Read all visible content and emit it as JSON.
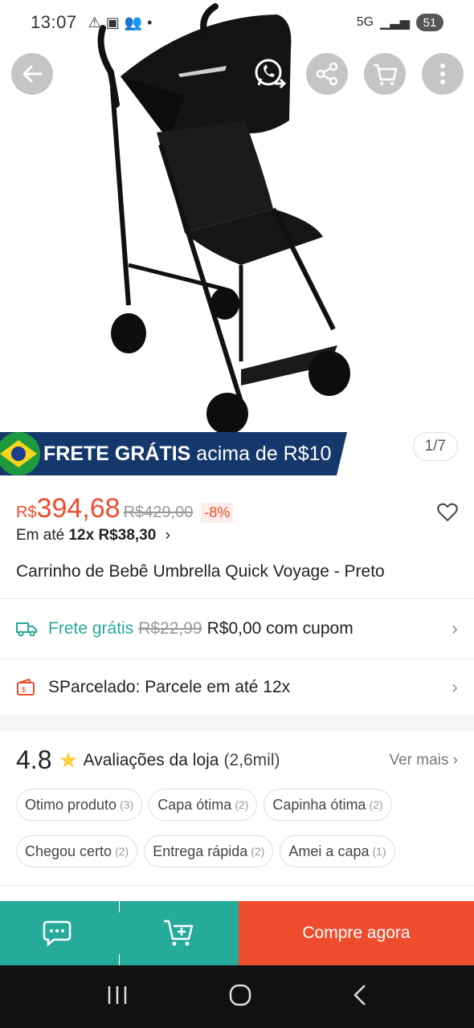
{
  "status_bar": {
    "time": "13:07",
    "network": "5G",
    "battery": "51"
  },
  "hero": {
    "counter": "1/7"
  },
  "top_actions": [
    "back-icon",
    "whatsapp-share-icon",
    "share-icon",
    "cart-icon",
    "more-icon"
  ],
  "banner": {
    "bold": "FRETE GRÁTIS",
    "rest": " acima de R$10"
  },
  "price": {
    "currency": "R$",
    "value": "394,68",
    "old": "R$429,00",
    "discount": "-8%"
  },
  "installment": {
    "prefix": "Em até ",
    "bold": "12x R$38,30",
    "chevron": "›"
  },
  "product_title": "Carrinho de Bebê Umbrella Quick Voyage - Preto",
  "shipping": {
    "label": "Frete grátis",
    "old": "R$22,99",
    "new": "R$0,00 com cupom"
  },
  "sparcelado": {
    "label": "SParcelado: Parcele em até 12x"
  },
  "rating": {
    "value": "4.8",
    "label": "Avaliações da loja",
    "count": "(2,6mil)",
    "see_more": "Ver mais"
  },
  "chips": [
    {
      "label": "Otimo produto",
      "count": "(3)"
    },
    {
      "label": "Capa ótima",
      "count": "(2)"
    },
    {
      "label": "Capinha ótima",
      "count": "(2)"
    },
    {
      "label": "Chegou certo",
      "count": "(2)"
    },
    {
      "label": "Entrega rápida",
      "count": "(2)"
    },
    {
      "label": "Amei a capa",
      "count": "(1)"
    }
  ],
  "actions": {
    "buy": "Compre agora"
  },
  "colors": {
    "accent": "#ee4d2d",
    "teal": "#26aa99",
    "banner": "#14386b"
  }
}
